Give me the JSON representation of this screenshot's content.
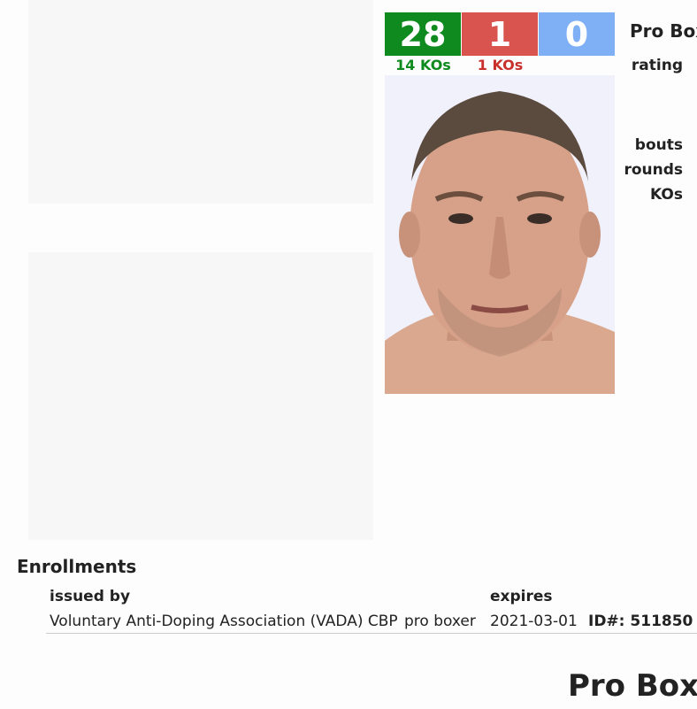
{
  "record": {
    "wins": "28",
    "losses": "1",
    "draws": "0",
    "win_kos": "14 KOs",
    "loss_kos": "1 KOs"
  },
  "sidebar_labels": {
    "pro_boxing": "Pro Box",
    "rating": "rating",
    "bouts": "bouts",
    "rounds": "rounds",
    "kos": "KOs"
  },
  "enrollments": {
    "title": "Enrollments",
    "headers": {
      "issued_by": "issued by",
      "expires": "expires"
    },
    "rows": [
      {
        "issuer": "Voluntary Anti-Doping Association (VADA) CBP",
        "role": "pro boxer",
        "expires": "2021-03-01",
        "id_label": "ID#:",
        "id_value": "511850"
      }
    ]
  },
  "bottom_heading": "Pro Boxi",
  "colors": {
    "win": "#0f8a1e",
    "loss": "#d9534f",
    "draw": "#7fb0f5"
  }
}
